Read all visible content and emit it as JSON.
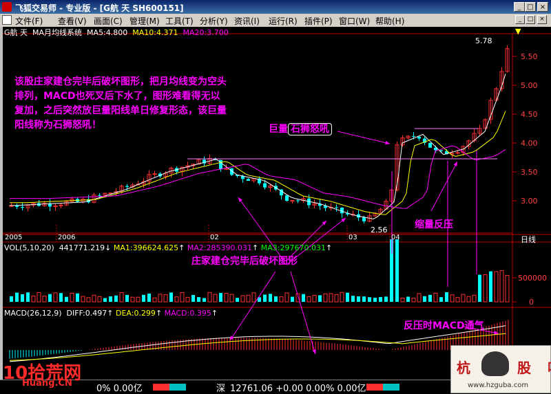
{
  "window": {
    "title": "飞狐交易师 - 专业版 - [G航 天 SH600151]",
    "min_glyph": "_",
    "max_glyph": "□",
    "close_glyph": "×"
  },
  "menu": [
    "文件(F)",
    "查看(V)",
    "画面(C)",
    "管理(M)",
    "工具(T)",
    "分析(Y)",
    "资讯(I)",
    "运行(R)",
    "插件(P)",
    "窗口(W)",
    "帮助(H)"
  ],
  "price_panel": {
    "header": {
      "symbol": "G航 天",
      "indicator": "MA月均线系统",
      "ma5": "MA5:4.800",
      "ma10": "MA10:4.371",
      "ma20": "MA20:3.700"
    },
    "y_ticks": [
      "5.50",
      "5.00",
      "4.50",
      "4.00",
      "3.50",
      "3.00"
    ],
    "high_label": "5.78",
    "low_label": "2.56",
    "period_label": "日线",
    "x_labels": [
      "2005",
      "2006",
      "02",
      "03",
      "04"
    ]
  },
  "volume_panel": {
    "header": {
      "name": "VOL(5,10,20)",
      "vol": "441771.219",
      "ma1": "MA1:396624.625",
      "ma2": "MA2:285390.031",
      "ma3": "MA3:297670.031"
    },
    "y_ticks": [
      "500000",
      "0"
    ]
  },
  "macd_panel": {
    "header": {
      "name": "MACD(26,12,9)",
      "diff": "DIFF:0.497",
      "dea": "DEA:0.299",
      "macd": "MACD:0.395"
    }
  },
  "annotations": {
    "main_note": "该股庄家建仓完毕后破坏图形，把月均线变为空头排列，MACD也死叉后下水了，图形难看得无以复加，之后突然放巨量阳线单日修复形态，该巨量阳线称为石狮怒吼！",
    "big_volume_prefix": "巨量",
    "big_volume_boxed": "石狮怒吼",
    "shrink_retest": "缩量反压",
    "destroy_pattern": "庄家建仓完毕后破坏图形",
    "macd_breath": "反压时MACD通气"
  },
  "status_bar": {
    "left": "0%  0.00亿",
    "sz_label": "深",
    "sz_value": "12761.06  +0.00  0.00%  0.00亿"
  },
  "watermarks": {
    "left_brand": "10拾荒网",
    "left_url": "Huang.CN",
    "right_brand": "杭州股吧",
    "right_url": "www.hzguba.com"
  },
  "colors": {
    "up": "#ff3030",
    "down": "#00ffff",
    "ma5": "#ffffff",
    "ma10": "#ffff00",
    "ma20": "#ff00ff",
    "annotation": "#ff00ff",
    "axis": "#c00000"
  }
}
